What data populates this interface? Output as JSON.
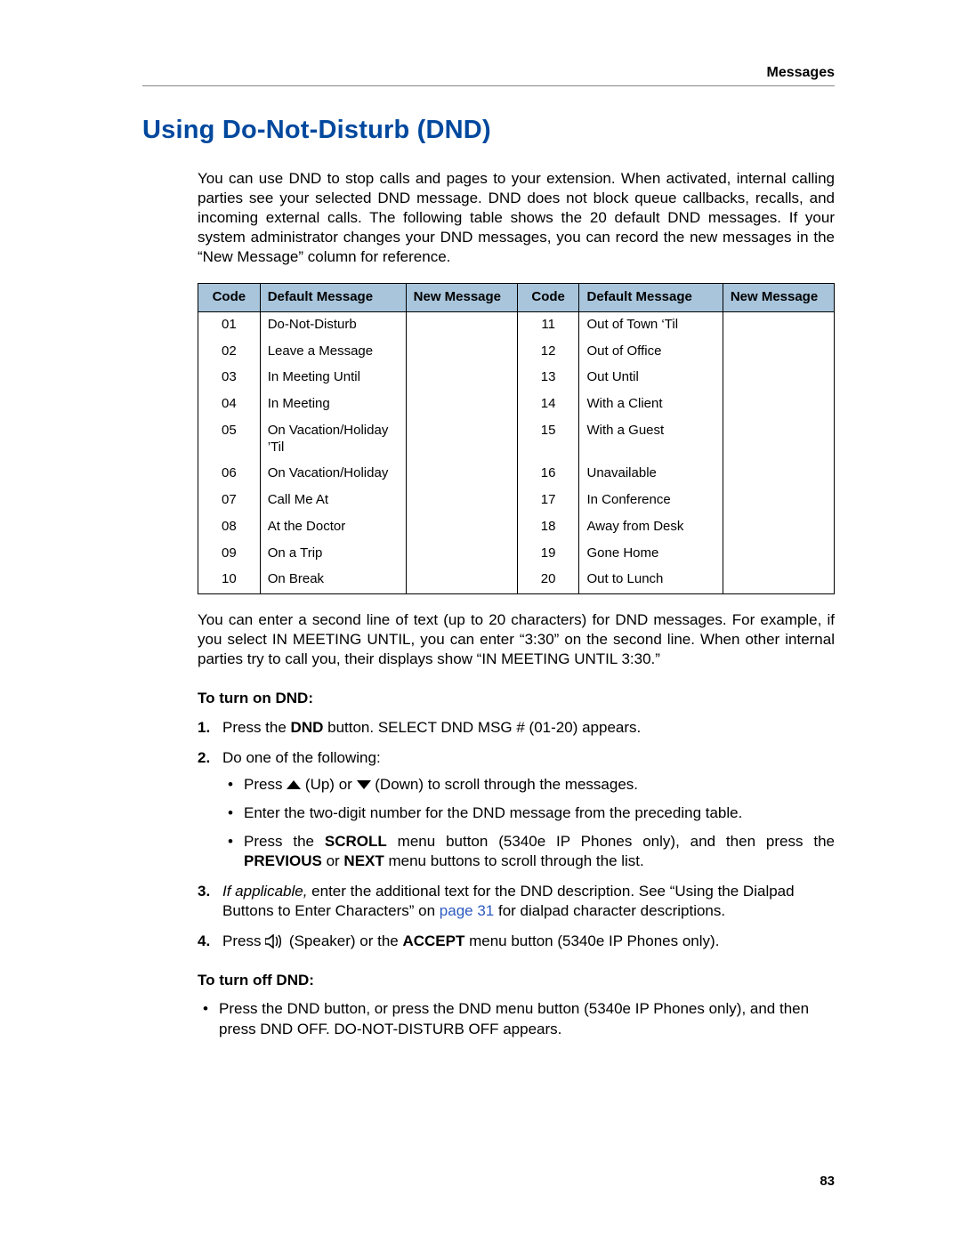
{
  "running_header": "Messages",
  "page_number": "83",
  "title": "Using Do-Not-Disturb (DND)",
  "intro": "You can use DND to stop calls and pages to your extension. When activated, internal calling parties see your selected DND message. DND does not block queue callbacks, recalls, and incoming external calls. The following table shows the 20 default DND messages. If your system administrator changes your DND messages, you can record the new messages in the “New Message” column for reference.",
  "table": {
    "headers": {
      "code": "Code",
      "default_message": "Default Message",
      "new_message": "New Message"
    },
    "rows": [
      {
        "c1": "01",
        "m1": "Do-Not-Disturb",
        "n1": "",
        "c2": "11",
        "m2": "Out of Town ‘Til",
        "n2": ""
      },
      {
        "c1": "02",
        "m1": "Leave a Message",
        "n1": "",
        "c2": "12",
        "m2": "Out of Office",
        "n2": ""
      },
      {
        "c1": "03",
        "m1": "In Meeting Until",
        "n1": "",
        "c2": "13",
        "m2": "Out Until",
        "n2": ""
      },
      {
        "c1": "04",
        "m1": "In Meeting",
        "n1": "",
        "c2": "14",
        "m2": "With a Client",
        "n2": ""
      },
      {
        "c1": "05",
        "m1": "On Vacation/Holiday ’Til",
        "n1": "",
        "c2": "15",
        "m2": "With a Guest",
        "n2": ""
      },
      {
        "c1": "06",
        "m1": "On Vacation/Holiday",
        "n1": "",
        "c2": "16",
        "m2": "Unavailable",
        "n2": ""
      },
      {
        "c1": "07",
        "m1": "Call Me At",
        "n1": "",
        "c2": "17",
        "m2": "In Conference",
        "n2": ""
      },
      {
        "c1": "08",
        "m1": "At the Doctor",
        "n1": "",
        "c2": "18",
        "m2": "Away from Desk",
        "n2": ""
      },
      {
        "c1": "09",
        "m1": "On a Trip",
        "n1": "",
        "c2": "19",
        "m2": "Gone Home",
        "n2": ""
      },
      {
        "c1": "10",
        "m1": "On Break",
        "n1": "",
        "c2": "20",
        "m2": "Out to Lunch",
        "n2": ""
      }
    ]
  },
  "after_table": "You can enter a second line of text (up to 20 characters) for DND messages. For example, if you select IN MEETING UNTIL, you can enter “3:30” on the second line. When other internal parties try to call you, their displays show “IN MEETING UNTIL 3:30.”",
  "turn_on": {
    "heading": "To turn on DND:",
    "step1_a": "Press the ",
    "step1_b": "DND",
    "step1_c": " button. SELECT DND MSG # (01-20) appears.",
    "step2": "Do one of the following:",
    "step2_b1_a": "Press ",
    "step2_b1_b": " (Up) or ",
    "step2_b1_c": " (Down) to scroll through the messages.",
    "step2_b2": "Enter the two-digit number for the DND message from the preceding table.",
    "step2_b3_a": "Press the ",
    "step2_b3_b": "SCROLL",
    "step2_b3_c": " menu button (5340e IP Phones only), and then press the ",
    "step2_b3_d": "PREVIOUS",
    "step2_b3_e": " or ",
    "step2_b3_f": "NEXT",
    "step2_b3_g": " menu buttons to scroll through the list.",
    "step3_a": "If applicable,",
    "step3_b": " enter the additional text for the DND description. See “Using the Dialpad Buttons to Enter Characters” on ",
    "step3_link": "page 31",
    "step3_c": " for dialpad character descriptions.",
    "step4_a": "Press ",
    "step4_b": " (Speaker) or the ",
    "step4_c": "ACCEPT",
    "step4_d": " menu button (5340e IP Phones only)."
  },
  "turn_off": {
    "heading": "To turn off DND:",
    "bullet": "Press the DND button, or press the DND menu button (5340e IP Phones only), and then press DND OFF. DO-NOT-DISTURB OFF appears."
  }
}
